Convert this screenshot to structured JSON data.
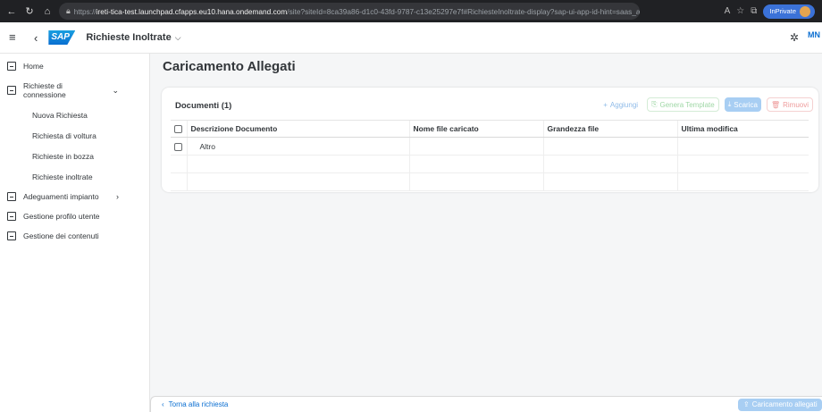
{
  "browser": {
    "url_prefix": "https://",
    "url_host": "ireti-tica-test.launchpad.cfapps.eu10.hana.ondemand.com",
    "url_path": "/site?siteId=8ca39a86-d1c0-43fd-9787-c13e25297e7f#RichiesteInoltrate-display?sap-ui-app-id-hint=saas_approuter...",
    "inprivate_label": "InPrivate"
  },
  "shell": {
    "logo_text": "SAP",
    "app_title": "Richieste Inoltrate",
    "avatar_initials": "MN"
  },
  "sidebar": {
    "items": [
      {
        "label": "Home"
      },
      {
        "label": "Richieste di connessione"
      },
      {
        "label": "Adeguamenti impianto"
      },
      {
        "label": "Gestione profilo utente"
      },
      {
        "label": "Gestione dei contenuti"
      }
    ],
    "subitems": [
      {
        "label": "Nuova Richiesta"
      },
      {
        "label": "Richiesta di voltura"
      },
      {
        "label": "Richieste in bozza"
      },
      {
        "label": "Richieste inoltrate"
      }
    ]
  },
  "main": {
    "page_title": "Caricamento Allegati",
    "table_title": "Documenti (1)",
    "toolbar": {
      "add": "Aggiungi",
      "generate": "Genera Template",
      "download": "Scarica",
      "remove": "Rimuovi"
    },
    "columns": [
      "Descrizione Documento",
      "Nome file caricato",
      "Grandezza file",
      "Ultima modifica"
    ],
    "rows": [
      {
        "description": "Altro",
        "file_name": "",
        "size": "",
        "modified": ""
      }
    ]
  },
  "footer": {
    "back_label": "Torna alla richiesta",
    "cta_label": "Caricamento allegati"
  }
}
